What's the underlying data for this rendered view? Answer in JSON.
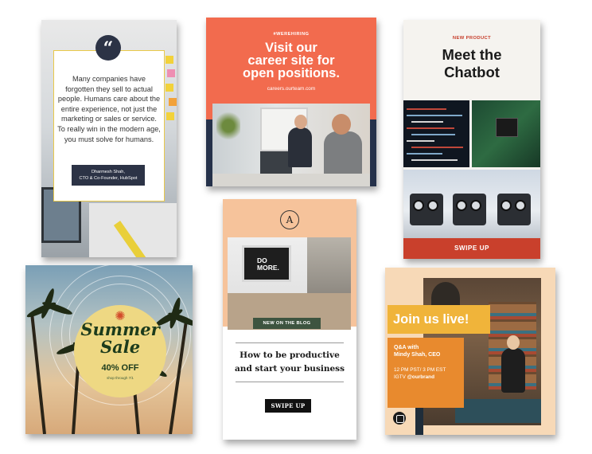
{
  "quote_card": {
    "quote": "Many companies have forgotten they sell to actual people. Humans care about the entire experience, not just the marketing or sales or service. To really win in the modern age, you must solve for humans.",
    "author_name": "Dharmesh Shah,",
    "author_title": "CTO & Co-Founder, HubSpot",
    "quote_icon": "quote-icon",
    "accent_color": "#2c3346"
  },
  "hiring_card": {
    "hashtag": "#WEREHIRING",
    "headline_1": "Visit our",
    "headline_2": "career site for",
    "headline_3": "open positions.",
    "url": "careers.ourteam.com",
    "background_color": "#f26b4e"
  },
  "chatbot_card": {
    "eyebrow": "NEW PRODUCT",
    "title_1": "Meet the",
    "title_2": "Chatbot",
    "cta": "SWIPE UP",
    "accent_color": "#c9402c"
  },
  "sale_card": {
    "word_1": "Summer",
    "word_2": "Sale",
    "discount": "40% OFF",
    "fine_print": "shop through 7/1",
    "sun_icon": "sun-icon",
    "disc_color": "#eed883"
  },
  "blog_card": {
    "logo_letter": "A",
    "monitor_text_1": "DO",
    "monitor_text_2": "MORE.",
    "tag": "NEW ON THE BLOG",
    "title_1": "How to be productive",
    "title_2": "and start your business",
    "cta": "SWIPE UP",
    "background_color": "#f6c39b"
  },
  "live_card": {
    "headline": "Join us live!",
    "qa_line_1": "Q&A with",
    "qa_line_2": "Mindy Shah, CEO",
    "time": "12 PM PST/ 3 PM EST",
    "platform": "IGTV",
    "handle": "@ourbrand",
    "live_icon": "igtv-icon",
    "accent_color": "#f0b43a"
  }
}
